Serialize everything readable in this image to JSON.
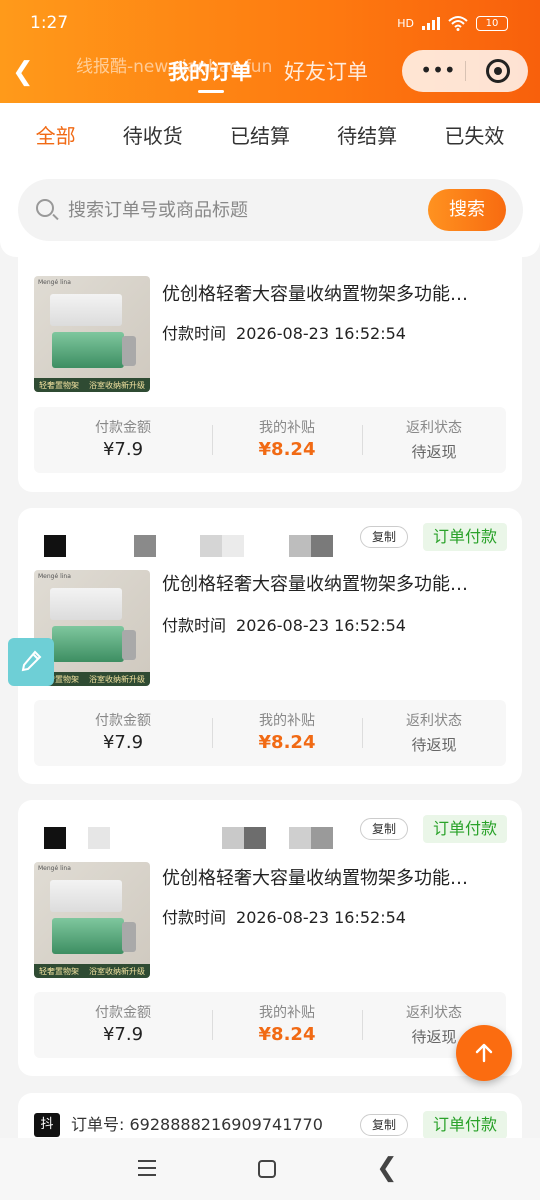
{
  "status_bar": {
    "time": "1:27",
    "battery": "10",
    "network": "HD"
  },
  "header": {
    "back_icon": "chevron-left-icon",
    "watermark": "线报酷-new.xianbao.fun",
    "tabs": [
      {
        "label": "我的订单",
        "active": true
      },
      {
        "label": "好友订单",
        "active": false
      }
    ],
    "more_icon": "more-dots-icon",
    "target_icon": "target-icon"
  },
  "filter_tabs": [
    {
      "label": "全部",
      "active": true
    },
    {
      "label": "待收货",
      "active": false
    },
    {
      "label": "已结算",
      "active": false
    },
    {
      "label": "待结算",
      "active": false
    },
    {
      "label": "已失效",
      "active": false
    }
  ],
  "search": {
    "placeholder": "搜索订单号或商品标题",
    "button": "搜索"
  },
  "orders": [
    {
      "title": "优创格轻奢大容量收纳置物架多功能…",
      "pay_time_label": "付款时间",
      "pay_time": "2026-08-23 16:52:54",
      "thumb": {
        "top_tag": "Mengé lina",
        "caption_left": "轻奢置物架",
        "caption_right": "浴室收纳新升级"
      },
      "stats": {
        "amount_label": "付款金额",
        "amount": "¥7.9",
        "subsidy_label": "我的补贴",
        "subsidy": "¥8.24",
        "rebate_label": "返利状态",
        "rebate": "待返现"
      }
    },
    {
      "copy": "复制",
      "status": "订单付款",
      "title": "优创格轻奢大容量收纳置物架多功能…",
      "pay_time_label": "付款时间",
      "pay_time": "2026-08-23 16:52:54",
      "thumb": {
        "top_tag": "Mengé lina",
        "caption_left": "轻奢置物架",
        "caption_right": "浴室收纳新升级"
      },
      "stats": {
        "amount_label": "付款金额",
        "amount": "¥7.9",
        "subsidy_label": "我的补贴",
        "subsidy": "¥8.24",
        "rebate_label": "返利状态",
        "rebate": "待返现"
      }
    },
    {
      "copy": "复制",
      "status": "订单付款",
      "title": "优创格轻奢大容量收纳置物架多功能…",
      "pay_time_label": "付款时间",
      "pay_time": "2026-08-23 16:52:54",
      "thumb": {
        "top_tag": "Mengé lina",
        "caption_left": "轻奢置物架",
        "caption_right": "浴室收纳新升级"
      },
      "stats": {
        "amount_label": "付款金额",
        "amount": "¥7.9",
        "subsidy_label": "我的补贴",
        "subsidy": "¥8.24",
        "rebate_label": "返利状态",
        "rebate": "待返现"
      }
    },
    {
      "platform": "抖",
      "order_no_label": "订单号:",
      "order_no": "6928888216909741770",
      "copy": "复制",
      "status": "订单付款"
    }
  ],
  "fab": {
    "icon": "arrow-up-icon"
  },
  "pen_tool": {
    "icon": "pen-icon"
  },
  "nav_bar": {
    "menu_icon": "menu-icon",
    "home_icon": "home-icon",
    "back_icon": "back-icon"
  }
}
